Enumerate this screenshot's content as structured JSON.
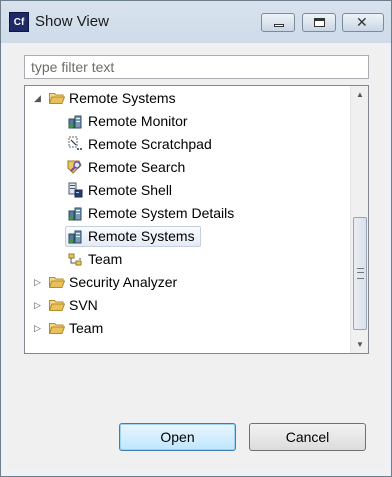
{
  "window": {
    "title": "Show View",
    "app_icon_text": "Cf",
    "close_glyph": "✕"
  },
  "filter": {
    "value": "",
    "placeholder": "type filter text"
  },
  "tree": {
    "items": [
      {
        "label": "Remote Systems",
        "type": "folder",
        "expanded": true
      },
      {
        "label": "Remote Monitor",
        "type": "view",
        "icon": "remote-monitor-icon"
      },
      {
        "label": "Remote Scratchpad",
        "type": "view",
        "icon": "scratchpad-icon"
      },
      {
        "label": "Remote Search",
        "type": "view",
        "icon": "search-icon"
      },
      {
        "label": "Remote Shell",
        "type": "view",
        "icon": "shell-icon"
      },
      {
        "label": "Remote System Details",
        "type": "view",
        "icon": "system-details-icon"
      },
      {
        "label": "Remote Systems",
        "type": "view",
        "icon": "remote-systems-icon",
        "selected": true
      },
      {
        "label": "Team",
        "type": "view",
        "icon": "team-icon"
      },
      {
        "label": "Security Analyzer",
        "type": "folder",
        "expanded": false
      },
      {
        "label": "SVN",
        "type": "folder",
        "expanded": false
      },
      {
        "label": "Team",
        "type": "folder",
        "expanded": false
      }
    ]
  },
  "buttons": {
    "open": "Open",
    "cancel": "Cancel"
  },
  "colors": {
    "folder": "#e8c15a",
    "selection": "#e5eaf3"
  }
}
